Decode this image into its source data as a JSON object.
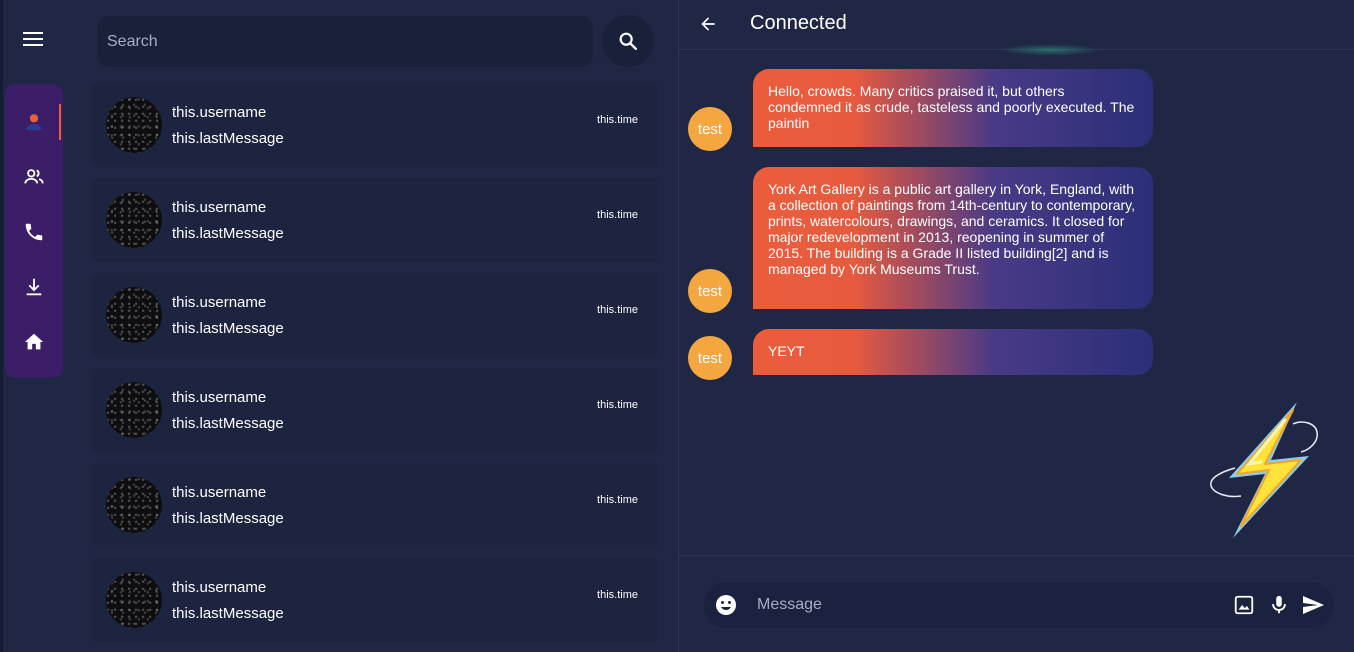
{
  "sidebar": {
    "menu_icon": "menu-icon",
    "items": [
      {
        "icon": "person-icon",
        "active": true
      },
      {
        "icon": "group-icon",
        "active": false
      },
      {
        "icon": "phone-icon",
        "active": false
      },
      {
        "icon": "download-icon",
        "active": false
      },
      {
        "icon": "home-icon",
        "active": false
      }
    ]
  },
  "search": {
    "placeholder": "Search",
    "value": ""
  },
  "conversations": [
    {
      "username": "this.username",
      "last_message": "this.lastMessage",
      "time": "this.time"
    },
    {
      "username": "this.username",
      "last_message": "this.lastMessage",
      "time": "this.time"
    },
    {
      "username": "this.username",
      "last_message": "this.lastMessage",
      "time": "this.time"
    },
    {
      "username": "this.username",
      "last_message": "this.lastMessage",
      "time": "this.time"
    },
    {
      "username": "this.username",
      "last_message": "this.lastMessage",
      "time": "this.time"
    },
    {
      "username": "this.username",
      "last_message": "this.lastMessage",
      "time": "this.time"
    }
  ],
  "chat": {
    "title": "Connected",
    "messages": [
      {
        "sender": "test",
        "text": "Hello,  crowds. Many critics praised it, but others condemned it as crude, tasteless and poorly executed. The paintin"
      },
      {
        "sender": "test",
        "text": "York Art Gallery is a public art gallery in York, England, with a collection of paintings from 14th-century to contemporary, prints, watercolours, drawings, and ceramics. It closed for major redevelopment in 2013, reopening in summer of 2015. The building is a Grade II listed building[2] and is managed by York Museums Trust."
      },
      {
        "sender": "test",
        "text": "YEYT"
      }
    ],
    "composer": {
      "placeholder": "Message",
      "value": ""
    }
  },
  "colors": {
    "background": "#1f2744",
    "nav_rail": "#3b1e67",
    "accent": "#e8603a",
    "sender_avatar": "#f4a741",
    "bubble_gradient_start": "#ea5d3c",
    "bubble_gradient_end": "#2b2f78"
  }
}
